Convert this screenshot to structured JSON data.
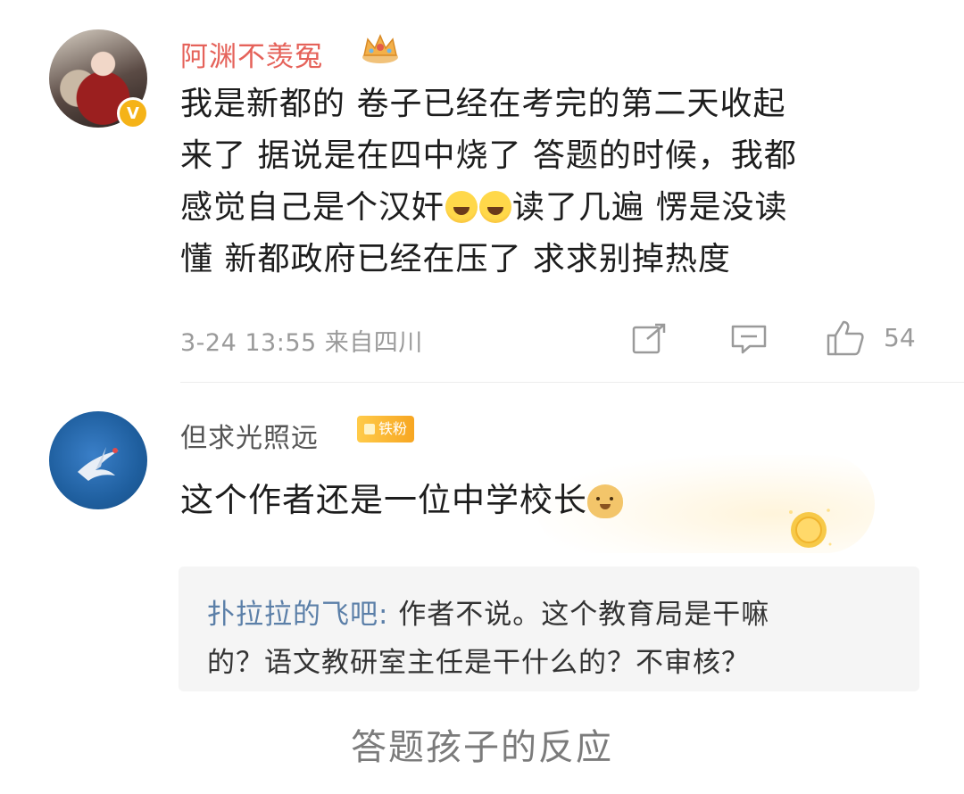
{
  "comment1": {
    "username": "阿渊不羡冤",
    "body_lines": [
      "我是新都的 卷子已经在考完的第二天收起",
      "来了 据说是在四中烧了 答题的时候，我都",
      "感觉自己是个汉奸",
      "读了几遍 愣是没读",
      "懂 新都政府已经在压了 求求别掉热度"
    ],
    "timestamp": "3-24 13:55",
    "location": "来自四川",
    "like_count": "54",
    "icons": [
      "crown-icon",
      "laugh-cry-emoji",
      "share-icon",
      "comment-icon",
      "like-icon"
    ]
  },
  "comment2": {
    "username": "但求光照远",
    "badge": "铁粉",
    "body": "这个作者还是一位中学校长",
    "icons": [
      "dog-emoji",
      "coin-icon"
    ]
  },
  "reply": {
    "author": "扑拉拉的飞吧:",
    "text_line1": " 作者不说。这个教育局是干嘛",
    "text_line2": "的？语文教研室主任是干什么的？不审核？"
  },
  "caption": "答题孩子的反应",
  "colors": {
    "username_red": "#e5625a",
    "meta_gray": "#9a9a9a",
    "reply_author": "#5b7fa8",
    "badge_gold": "#f5b318"
  }
}
